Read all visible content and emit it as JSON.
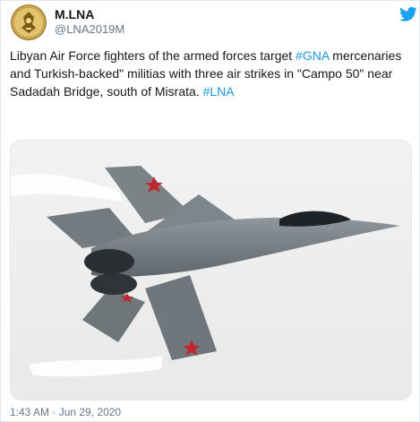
{
  "author": {
    "name": "M.LNA",
    "handle": "@LNA2019M"
  },
  "tweet": {
    "text_part1": "Libyan Air Force fighters of the armed forces target ",
    "hashtag1": "#GNA",
    "text_part2": " mercenaries and Turkish-backed\" militias with three air strikes in \"Campo 50\" near Sadadah Bridge, south of Misrata. ",
    "hashtag2": "#LNA"
  },
  "timestamp": "1:43 AM · Jun 29, 2020",
  "colors": {
    "link": "#1b95e0",
    "twitter_blue": "#1da1f2",
    "meta_gray": "#657786"
  },
  "icons": {
    "brand": "twitter-bird-icon"
  }
}
